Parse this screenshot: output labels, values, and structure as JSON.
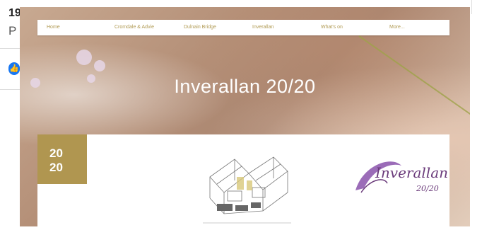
{
  "background_page": {
    "title_fragment": "19",
    "sub_fragment": "P"
  },
  "nav": {
    "items": [
      {
        "label": "Home"
      },
      {
        "label": "Cromdale & Advie"
      },
      {
        "label": "Dulnain Bridge"
      },
      {
        "label": "Inverallan"
      },
      {
        "label": "What's on"
      },
      {
        "label": "More..."
      }
    ]
  },
  "hero": {
    "title": "Inverallan 20/20"
  },
  "card": {
    "badge_line1": "20",
    "badge_line2": "20",
    "logo_text": "Inverallan",
    "logo_sub": "20/20"
  },
  "colors": {
    "accent_gold": "#b09650",
    "nav_text": "#b09a53",
    "logo_purple": "#6a3a7a"
  }
}
